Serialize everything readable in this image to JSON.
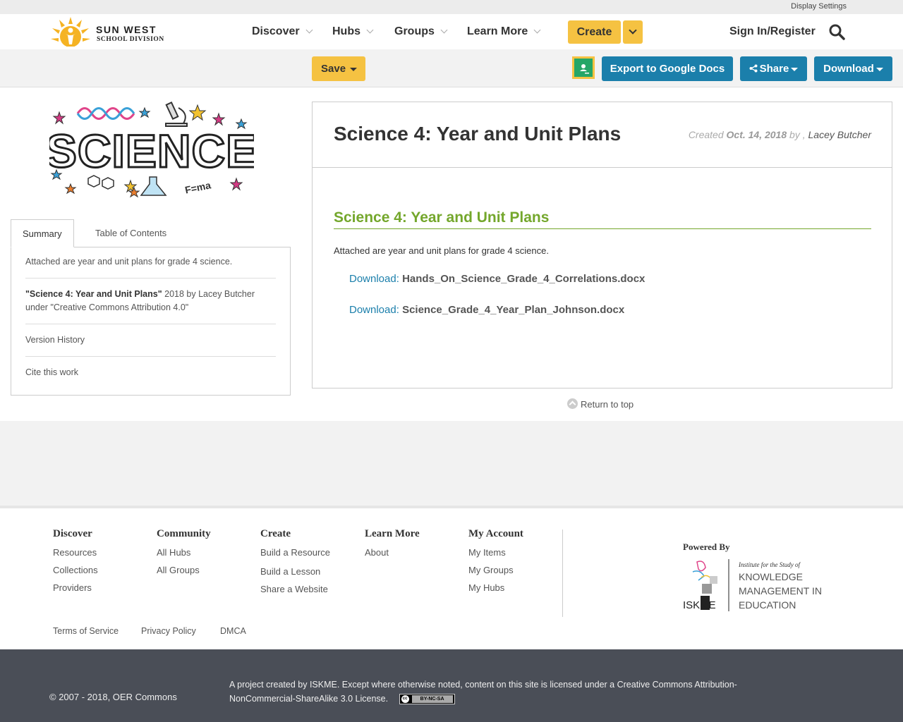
{
  "util_bar": {
    "display_settings": "Display Settings"
  },
  "brand": {
    "line1": "SUN WEST",
    "line2": "SCHOOL DIVISION"
  },
  "nav": {
    "items": [
      "Discover",
      "Hubs",
      "Groups",
      "Learn More"
    ],
    "create_label": "Create",
    "signin_label": "Sign In/Register"
  },
  "toolbar": {
    "save_label": "Save",
    "export_label": "Export to Google Docs",
    "share_label": "Share",
    "download_label": "Download"
  },
  "sidebar": {
    "tabs": [
      "Summary",
      "Table of Contents"
    ],
    "summary_text": "Attached are year and unit plans for grade 4 science.",
    "attribution_title": "\"Science 4: Year and Unit Plans\"",
    "attribution_rest": " 2018 by Lacey Butcher under \"Creative Commons Attribution 4.0\"",
    "version_history": "Version History",
    "cite_this_work": "Cite this work"
  },
  "content": {
    "title": "Science 4: Year and Unit Plans",
    "created_prefix": "Created",
    "created_date": "Oct. 14, 2018",
    "created_by": "by ,",
    "author": "Lacey Butcher",
    "section_title": "Science 4: Year and Unit Plans",
    "description": "Attached are year and unit plans for grade 4 science.",
    "downloads": [
      {
        "label": "Download:",
        "file": "Hands_On_Science_Grade_4_Correlations.docx"
      },
      {
        "label": "Download:",
        "file": "Science_Grade_4_Year_Plan_Johnson.docx"
      }
    ],
    "return_to_top": "Return to top"
  },
  "footer": {
    "columns": [
      {
        "heading": "Discover",
        "links": [
          "Resources",
          "Collections",
          "Providers"
        ]
      },
      {
        "heading": "Community",
        "links": [
          "All Hubs",
          "All Groups"
        ]
      },
      {
        "heading": "Create",
        "links": [
          "Build a Resource",
          "Build a Lesson",
          "Share a Website"
        ]
      },
      {
        "heading": "Learn More",
        "links": [
          "About"
        ]
      },
      {
        "heading": "My Account",
        "links": [
          "My Items",
          "My Groups",
          "My Hubs"
        ]
      }
    ],
    "powered_by": "Powered By",
    "iskme_text": [
      "Institute for the Study of",
      "KNOWLEDGE",
      "MANAGEMENT IN",
      "EDUCATION"
    ],
    "iskme_mark": "ISKME",
    "legal_links": [
      "Terms of Service",
      "Privacy Policy",
      "DMCA"
    ],
    "copyright": "© 2007 - 2018, OER Commons",
    "project_note": "A project created by ISKME. Except where otherwise noted, content on this site is licensed under a Creative Commons Attribution-NonCommercial-ShareAlike 3.0 License.",
    "cc_badge_text": "BY-NC-SA"
  },
  "colors": {
    "accent_yellow": "#f5c242",
    "button_blue": "#1b7fab",
    "section_green": "#74a72c",
    "footer_dark": "#4a4e57"
  }
}
